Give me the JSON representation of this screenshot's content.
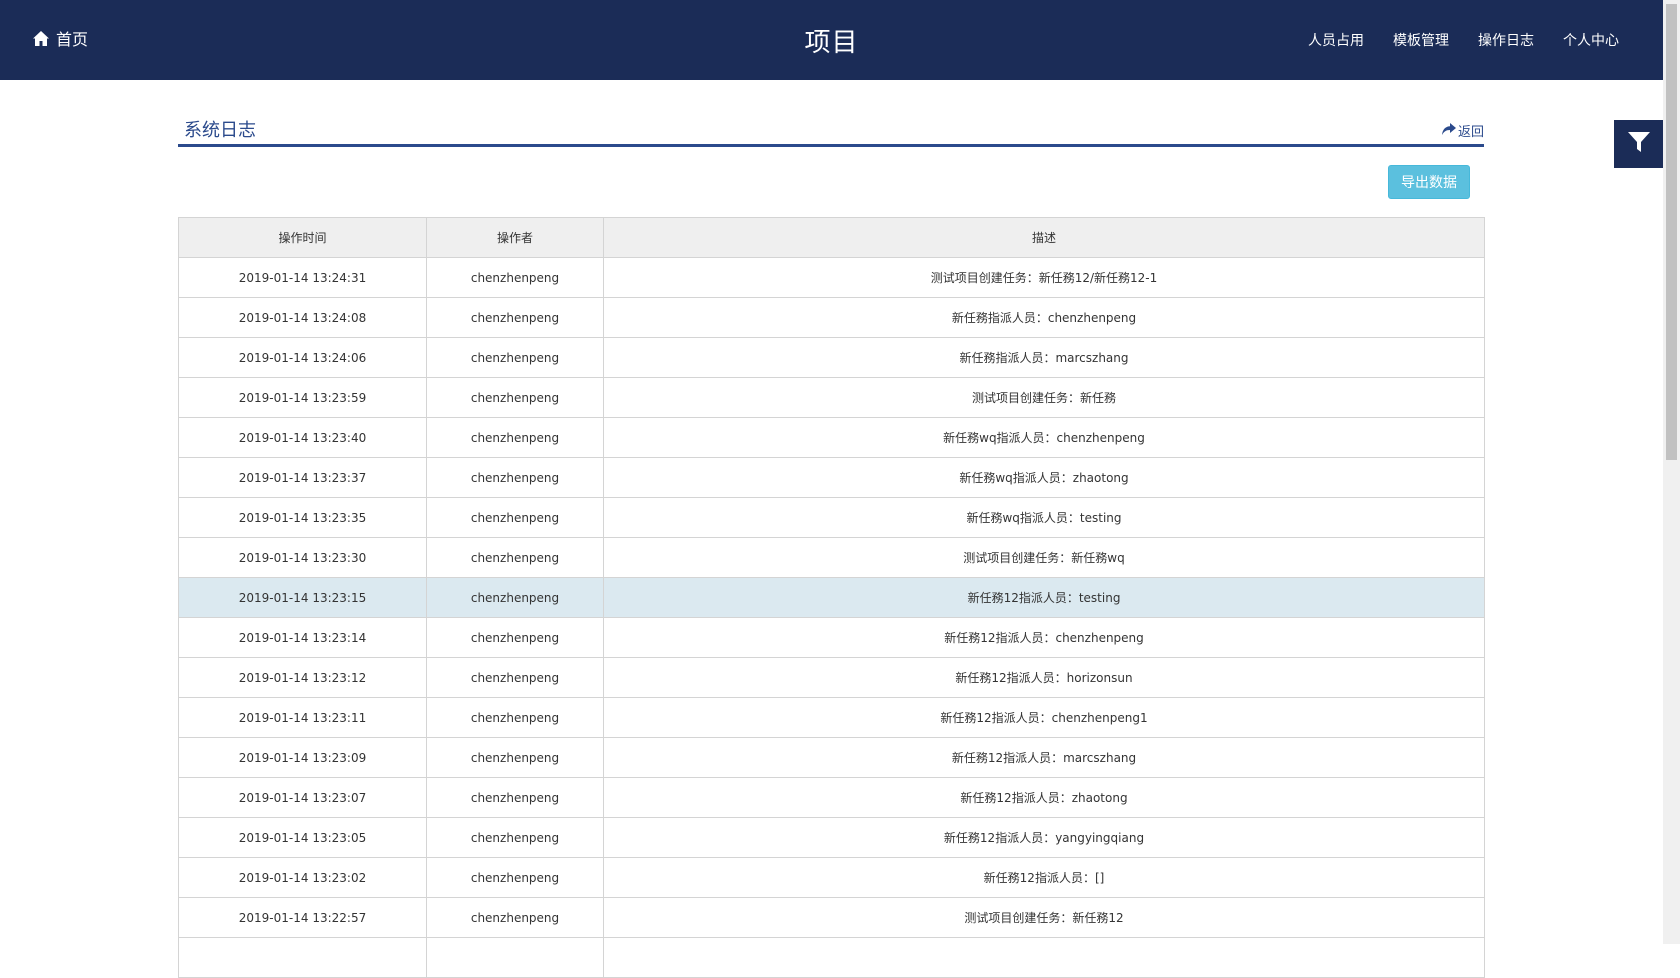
{
  "header": {
    "home_label": "首页",
    "title": "项目",
    "nav": [
      "人员占用",
      "模板管理",
      "操作日志",
      "个人中心"
    ],
    "background": "#1b2c57"
  },
  "section": {
    "title": "系统日志",
    "back_label": "返回",
    "accent": "#2b4a8c"
  },
  "toolbar": {
    "export_label": "导出数据",
    "export_color": "#5bc0de",
    "filter_icon": "filter-icon"
  },
  "table": {
    "columns": [
      "操作时间",
      "操作者",
      "描述"
    ],
    "highlight_color": "#dbe9f0",
    "rows": [
      {
        "time": "2019-01-14 13:24:31",
        "operator": "chenzhenpeng",
        "desc": "测试项目创建任务：新任務12/新任務12-1"
      },
      {
        "time": "2019-01-14 13:24:08",
        "operator": "chenzhenpeng",
        "desc": "新任務指派人员：chenzhenpeng"
      },
      {
        "time": "2019-01-14 13:24:06",
        "operator": "chenzhenpeng",
        "desc": "新任務指派人员：marcszhang"
      },
      {
        "time": "2019-01-14 13:23:59",
        "operator": "chenzhenpeng",
        "desc": "测试项目创建任务：新任務"
      },
      {
        "time": "2019-01-14 13:23:40",
        "operator": "chenzhenpeng",
        "desc": "新任務wq指派人员：chenzhenpeng"
      },
      {
        "time": "2019-01-14 13:23:37",
        "operator": "chenzhenpeng",
        "desc": "新任務wq指派人员：zhaotong"
      },
      {
        "time": "2019-01-14 13:23:35",
        "operator": "chenzhenpeng",
        "desc": "新任務wq指派人员：testing"
      },
      {
        "time": "2019-01-14 13:23:30",
        "operator": "chenzhenpeng",
        "desc": "测试项目创建任务：新任務wq"
      },
      {
        "time": "2019-01-14 13:23:15",
        "operator": "chenzhenpeng",
        "desc": "新任務12指派人员：testing",
        "highlight": true
      },
      {
        "time": "2019-01-14 13:23:14",
        "operator": "chenzhenpeng",
        "desc": "新任務12指派人员：chenzhenpeng"
      },
      {
        "time": "2019-01-14 13:23:12",
        "operator": "chenzhenpeng",
        "desc": "新任務12指派人员：horizonsun"
      },
      {
        "time": "2019-01-14 13:23:11",
        "operator": "chenzhenpeng",
        "desc": "新任務12指派人员：chenzhenpeng1"
      },
      {
        "time": "2019-01-14 13:23:09",
        "operator": "chenzhenpeng",
        "desc": "新任務12指派人员：marcszhang"
      },
      {
        "time": "2019-01-14 13:23:07",
        "operator": "chenzhenpeng",
        "desc": "新任務12指派人员：zhaotong"
      },
      {
        "time": "2019-01-14 13:23:05",
        "operator": "chenzhenpeng",
        "desc": "新任務12指派人员：yangyingqiang"
      },
      {
        "time": "2019-01-14 13:23:02",
        "operator": "chenzhenpeng",
        "desc": "新任務12指派人员：[]"
      },
      {
        "time": "2019-01-14 13:22:57",
        "operator": "chenzhenpeng",
        "desc": "测试项目创建任务：新任務12"
      },
      {
        "time": "",
        "operator": "",
        "desc": ""
      }
    ]
  }
}
